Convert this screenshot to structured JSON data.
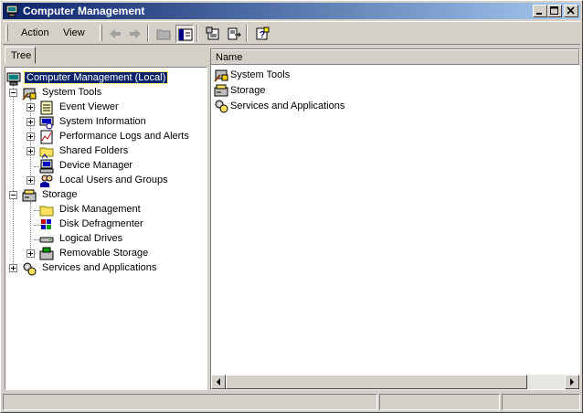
{
  "window": {
    "title": "Computer Management"
  },
  "menu": {
    "action": "Action",
    "view": "View"
  },
  "tabs": {
    "tree": "Tree"
  },
  "tree": {
    "root": "Computer Management (Local)",
    "system_tools": "System Tools",
    "event_viewer": "Event Viewer",
    "system_information": "System Information",
    "perf_logs": "Performance Logs and Alerts",
    "shared_folders": "Shared Folders",
    "device_manager": "Device Manager",
    "local_users": "Local Users and Groups",
    "storage": "Storage",
    "disk_management": "Disk Management",
    "disk_defrag": "Disk Defragmenter",
    "logical_drives": "Logical Drives",
    "removable_storage": "Removable Storage",
    "services_apps": "Services and Applications"
  },
  "list": {
    "column_name": "Name",
    "items": [
      "System Tools",
      "Storage",
      "Services and Applications"
    ]
  },
  "colors": {
    "title_start": "#0a246a",
    "title_end": "#a6caf0",
    "selection": "#0a246a",
    "chrome": "#d4d0c8"
  }
}
